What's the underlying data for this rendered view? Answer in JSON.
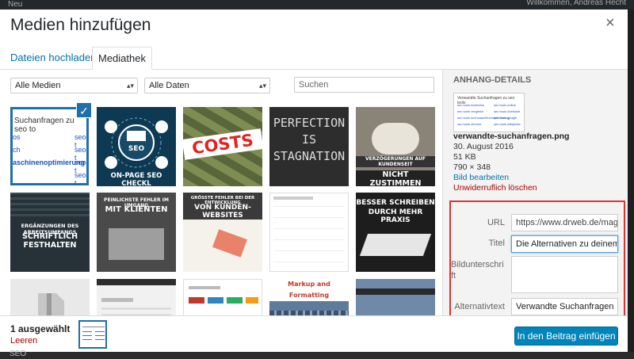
{
  "background": {
    "adminbar_left": "Neu",
    "adminbar_right": "Willkommen, Andreas Hecht",
    "bottom_text": "SEO"
  },
  "modal": {
    "title": "Medien hinzufügen",
    "close_label": "×",
    "tabs": [
      {
        "label": "Dateien hochladen"
      },
      {
        "label": "Mediathek"
      }
    ]
  },
  "toolbar": {
    "media_filter": "Alle Medien",
    "date_filter": "Alle Daten",
    "search_placeholder": "Suchen"
  },
  "grid": {
    "tile1_lines": [
      "Suchanfragen zu seo to",
      "os",
      "seo t",
      "ch",
      "seo t",
      "aschinenoptimierung",
      "seo t",
      "seo t"
    ],
    "captions": {
      "seo_checklist": "ON-PAGE SEO CHECKL",
      "costs": "COSTS",
      "perfection": "PERFECTION IS STAGNATION",
      "delays_top": "VERZÖGERUNGEN AUF KUNDENSEIT",
      "delays": "NICHT ZUSTIMMEN",
      "work_top": "ERGÄNZUNGEN DES ARBEITSUMFANGS",
      "work": "SCHRIFTLICH FESTHALTEN",
      "clients_top": "PEINLICHSTE FEHLER IM UMGANG",
      "clients": "MIT KLIENTEN",
      "websites_top": "GRÖSSTE FEHLER BEI DER ENTWICKLUNG",
      "websites": "VON KUNDEN-WEBSITES",
      "write_top": "BESSER SCHREIBEN",
      "write": "DURCH MEHR PRAXIS",
      "markup": "Markup and Formatting"
    }
  },
  "details": {
    "heading": "ANHANG-DETAILS",
    "filename": "verwandte-suchanfragen.png",
    "date": "30. August 2016",
    "size": "51 KB",
    "dimensions": "790 × 348",
    "edit_link": "Bild bearbeiten",
    "delete_link": "Unwiderruflich löschen",
    "thumb_title": "Verwandte Suchanfragen zu seo tools",
    "thumb_items": [
      "seo tools kostenlos",
      "seo tools online",
      "seo tools vergleich",
      "seo tools übersicht",
      "seo tools suchmaschinenoptimierung",
      "seo tools google",
      "seo tools chrome",
      "seo tools wikipedia"
    ],
    "fields": {
      "url_label": "URL",
      "url_value": "https://www.drweb.de/maga",
      "title_label": "Titel",
      "title_value": "Die Alternativen zu deinem",
      "caption_label": "Bildunterschrift",
      "alt_label": "Alternativtext",
      "alt_value": "Verwandte Suchanfragen"
    }
  },
  "footer": {
    "selected_count": "1 ausgewählt",
    "clear_label": "Leeren",
    "insert_button": "In den Beitrag einfügen"
  },
  "colors": {
    "primary": "#0085ba",
    "link": "#0073aa",
    "danger": "#a00000",
    "highlight_frame": "#dd3333"
  }
}
